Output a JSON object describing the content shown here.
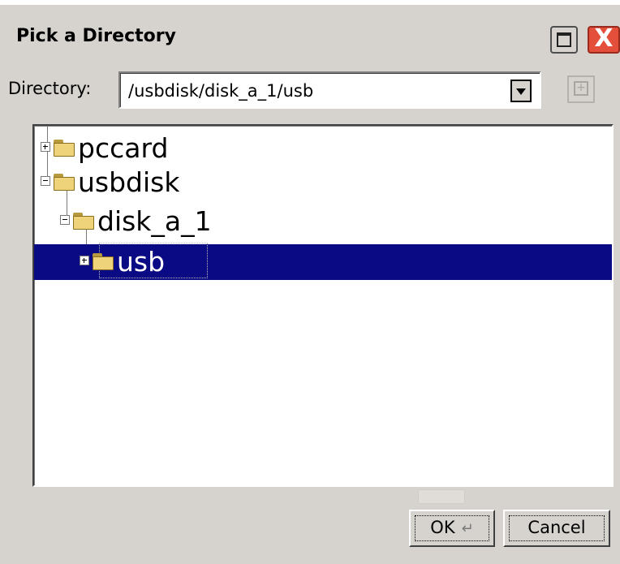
{
  "window": {
    "title": "Pick a Directory",
    "maximize_icon": "maximize-icon",
    "close_icon": "close-icon",
    "close_glyph": "X"
  },
  "directory": {
    "label": "Directory:",
    "value": "/usbdisk/disk_a_1/usb",
    "dropdown_icon": "chevron-down-icon",
    "new_folder_icon": "new-folder-icon"
  },
  "tree": {
    "nodes": [
      {
        "label": "pccard",
        "expander": "plus",
        "depth": 0,
        "selected": false
      },
      {
        "label": "usbdisk",
        "expander": "minus",
        "depth": 0,
        "selected": false
      },
      {
        "label": "disk_a_1",
        "expander": "minus",
        "depth": 1,
        "selected": false
      },
      {
        "label": "usb",
        "expander": "plus",
        "depth": 2,
        "selected": true
      }
    ]
  },
  "buttons": {
    "ok_label": "OK",
    "ok_icon": "enter-key-icon",
    "cancel_label": "Cancel"
  },
  "colors": {
    "dialog_bg": "#d6d3ce",
    "selection_bg": "#0a0a84",
    "close_button": "#e34f3b"
  }
}
